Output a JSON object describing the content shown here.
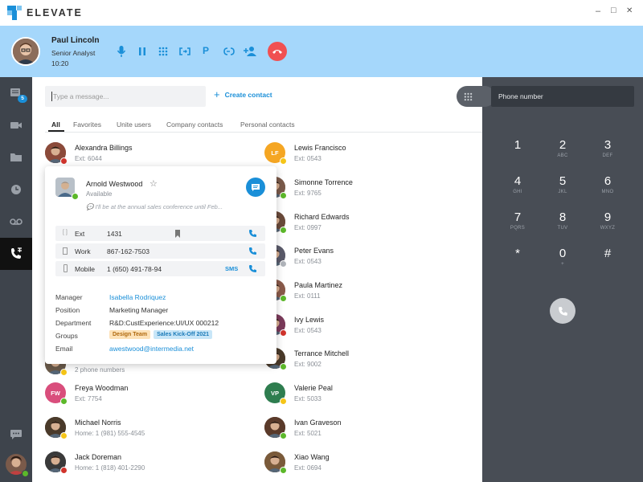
{
  "app": {
    "name": "ELEVATE",
    "brand_color": "#1a8fd8"
  },
  "window": {
    "min": "–",
    "max": "□",
    "close": "✕"
  },
  "call": {
    "name": "Paul Lincoln",
    "title": "Senior Analyst",
    "timer": "10:20",
    "controls": [
      "microphone-icon",
      "pause-icon",
      "keypad-icon",
      "transfer-icon",
      "park-icon",
      "merge-icon",
      "add-participant-icon"
    ],
    "park_label": "P",
    "hangup_color": "#f05052"
  },
  "nav": {
    "messages_badge": "5"
  },
  "search": {
    "placeholder": "Type a message...",
    "create_label": "Create contact"
  },
  "tabs": [
    {
      "label": "All",
      "active": true
    },
    {
      "label": "Favorites"
    },
    {
      "label": "Unite users"
    },
    {
      "label": "Company contacts"
    },
    {
      "label": "Personal contacts"
    }
  ],
  "contacts_left": [
    {
      "name": "Alexandra Billings",
      "ext": "Ext: 6044",
      "status": "busy",
      "photo": true,
      "avatar_color": "#8b4a3a"
    },
    {
      "name": "",
      "ext": "2 phone numbers",
      "status": "away",
      "photo": true,
      "avatar_color": "#6a5a4a"
    },
    {
      "name": "Freya Woodman",
      "ext": "Ext: 7754",
      "status": "available",
      "initials": "FW",
      "avatar_color": "#d94e7c"
    },
    {
      "name": "Michael Norris",
      "ext": "Home: 1 (981) 555-4545",
      "status": "away",
      "photo": true,
      "avatar_color": "#4a3a2a"
    },
    {
      "name": "Jack Doreman",
      "ext": "Home: 1 (818) 401-2290",
      "status": "busy",
      "photo": true,
      "avatar_color": "#3a3a3a"
    }
  ],
  "contacts_right": [
    {
      "name": "Lewis Francisco",
      "ext": "Ext: 0543",
      "status": "away",
      "initials": "LF",
      "avatar_color": "#f5a623"
    },
    {
      "name": "Simonne Torrence",
      "ext": "Ext: 9765",
      "status": "available",
      "photo": true,
      "avatar_color": "#7a5a4a"
    },
    {
      "name": "Richard Edwards",
      "ext": "Ext: 0997",
      "status": "available",
      "photo": true,
      "avatar_color": "#6a4a3a"
    },
    {
      "name": "Peter Evans",
      "ext": "Ext: 0543",
      "status": "offline",
      "photo": true,
      "avatar_color": "#5a5a6a"
    },
    {
      "name": "Paula Martinez",
      "ext": "Ext: 0111",
      "status": "available",
      "photo": true,
      "avatar_color": "#8a5a4a"
    },
    {
      "name": "Ivy Lewis",
      "ext": "Ext: 0543",
      "status": "dnd",
      "photo": true,
      "avatar_color": "#7a3a5a"
    },
    {
      "name": "Terrance Mitchell",
      "ext": "Ext: 9002",
      "status": "available",
      "photo": true,
      "avatar_color": "#4a3a2a"
    },
    {
      "name": "Valerie Peal",
      "ext": "Ext: 5033",
      "status": "away",
      "initials": "VP",
      "avatar_color": "#2e7d4f"
    },
    {
      "name": "Ivan Graveson",
      "ext": "Ext: 5021",
      "status": "available",
      "photo": true,
      "avatar_color": "#5a3a2a"
    },
    {
      "name": "Xiao Wang",
      "ext": "Ext: 0694",
      "status": "available",
      "photo": true,
      "avatar_color": "#7a5a3a"
    }
  ],
  "popup": {
    "name": "Arnold Westwood",
    "status": "Available",
    "note": "I'll be at the annual sales conference until Feb...",
    "phones": [
      {
        "label": "Ext",
        "value": "1431",
        "icon": "extension-icon",
        "bookmark": true
      },
      {
        "label": "Work",
        "value": "867-162-7503",
        "icon": "building-icon"
      },
      {
        "label": "Mobile",
        "value": "1 (650) 491-78-94",
        "icon": "mobile-icon",
        "sms": "SMS"
      }
    ],
    "details": {
      "manager_label": "Manager",
      "manager": "Isabella Rodriquez",
      "position_label": "Position",
      "position": "Marketing Manager",
      "department_label": "Department",
      "department": "R&D:CustExperience:UI/UX 000212",
      "groups_label": "Groups",
      "groups": [
        "Design Team",
        "Sales Kick-Off 2021"
      ],
      "email_label": "Email",
      "email": "awestwood@intermedia.net"
    }
  },
  "dialer": {
    "placeholder": "Phone number",
    "keys": [
      {
        "d": "1",
        "l": ""
      },
      {
        "d": "2",
        "l": "ABC"
      },
      {
        "d": "3",
        "l": "DEF"
      },
      {
        "d": "4",
        "l": "GHI"
      },
      {
        "d": "5",
        "l": "JKL"
      },
      {
        "d": "6",
        "l": "MNO"
      },
      {
        "d": "7",
        "l": "PQRS"
      },
      {
        "d": "8",
        "l": "TUV"
      },
      {
        "d": "9",
        "l": "WXYZ"
      },
      {
        "d": "*",
        "l": ""
      },
      {
        "d": "0",
        "l": "+"
      },
      {
        "d": "#",
        "l": ""
      }
    ]
  },
  "colors": {
    "accent": "#1a8fd8",
    "available": "#5cb82a",
    "away": "#f5c518",
    "busy": "#d0342c",
    "offline": "#b0b4ba",
    "dnd": "#d0342c"
  }
}
